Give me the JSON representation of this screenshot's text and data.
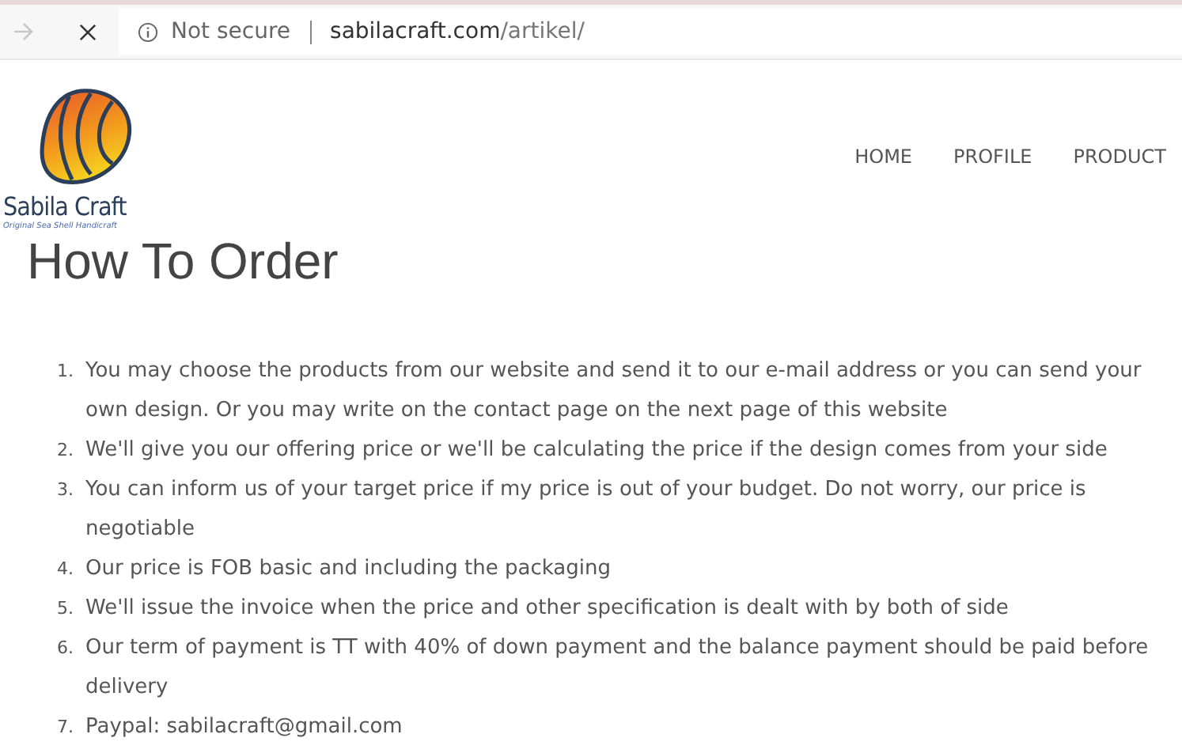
{
  "browser": {
    "security": "Not secure",
    "domain": "sabilacraft.com",
    "path": "/artikel/"
  },
  "logo": {
    "name": "Sabila Craft",
    "tagline": "Original Sea Shell Handicraft"
  },
  "nav": [
    {
      "label": "HOME"
    },
    {
      "label": "PROFILE"
    },
    {
      "label": "PRODUCT"
    }
  ],
  "title": "How To Order",
  "steps": [
    {
      "number": "1.",
      "text": "You may choose the products from our website and send it to our e-mail address or you can send your own design. Or you may write on the contact page on the next page of this website"
    },
    {
      "number": "2.",
      "text": "We'll give you our offering price or we'll be calculating the price if the design comes from your side"
    },
    {
      "number": "3.",
      "text": "You can inform us of your target price if my price is out of your budget. Do not worry, our price is negotiable"
    },
    {
      "number": "4.",
      "text": "Our price is FOB basic and including the packaging"
    },
    {
      "number": "5.",
      "text": "We'll issue the invoice when the price and other specification is dealt with by both of side"
    },
    {
      "number": "6.",
      "text": "Our term of payment is TT with 40% of down payment and the balance payment should be paid before delivery"
    },
    {
      "number": "7.",
      "text": "Paypal: sabilacraft@gmail.com"
    }
  ]
}
